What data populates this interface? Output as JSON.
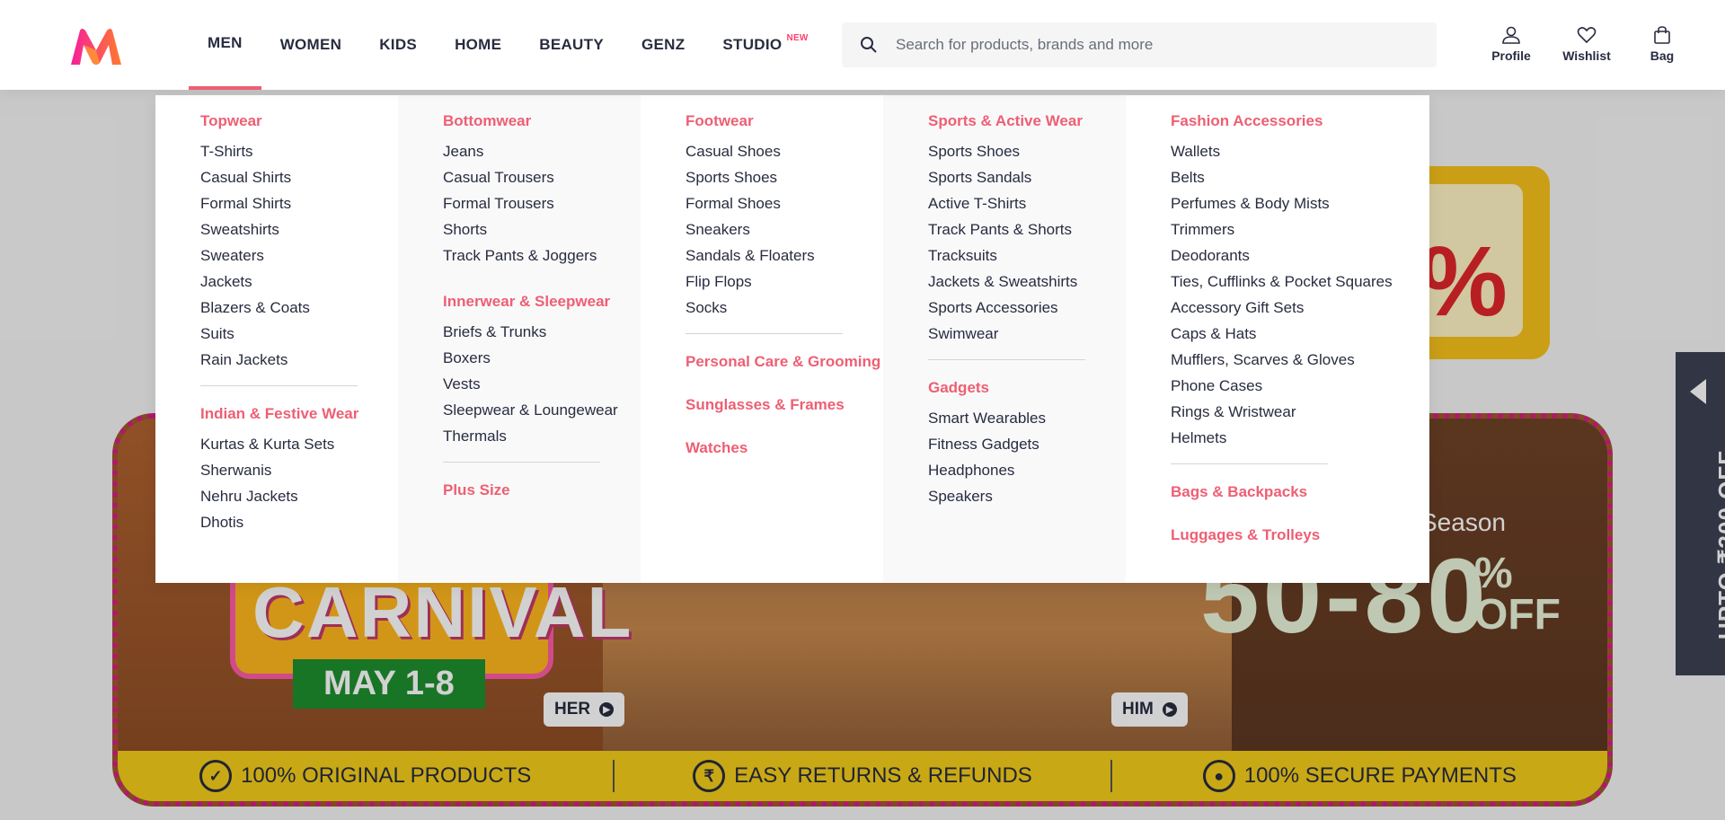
{
  "nav": {
    "items": [
      "MEN",
      "WOMEN",
      "KIDS",
      "HOME",
      "BEAUTY",
      "GENZ",
      "STUDIO"
    ],
    "studio_badge": "NEW"
  },
  "search": {
    "placeholder": "Search for products, brands and more"
  },
  "actions": {
    "profile": "Profile",
    "wishlist": "Wishlist",
    "bag": "Bag"
  },
  "menu": {
    "col1": {
      "g1": {
        "title": "Topwear",
        "items": [
          "T-Shirts",
          "Casual Shirts",
          "Formal Shirts",
          "Sweatshirts",
          "Sweaters",
          "Jackets",
          "Blazers & Coats",
          "Suits",
          "Rain Jackets"
        ]
      },
      "g2": {
        "title": "Indian & Festive Wear",
        "items": [
          "Kurtas & Kurta Sets",
          "Sherwanis",
          "Nehru Jackets",
          "Dhotis"
        ]
      }
    },
    "col2": {
      "g1": {
        "title": "Bottomwear",
        "items": [
          "Jeans",
          "Casual Trousers",
          "Formal Trousers",
          "Shorts",
          "Track Pants & Joggers"
        ]
      },
      "g2": {
        "title": "Innerwear & Sleepwear",
        "items": [
          "Briefs & Trunks",
          "Boxers",
          "Vests",
          "Sleepwear & Loungewear",
          "Thermals"
        ]
      },
      "g3": {
        "title": "Plus Size"
      }
    },
    "col3": {
      "g1": {
        "title": "Footwear",
        "items": [
          "Casual Shoes",
          "Sports Shoes",
          "Formal Shoes",
          "Sneakers",
          "Sandals & Floaters",
          "Flip Flops",
          "Socks"
        ]
      },
      "g2": {
        "title": "Personal Care & Grooming"
      },
      "g3": {
        "title": "Sunglasses & Frames"
      },
      "g4": {
        "title": "Watches"
      }
    },
    "col4": {
      "g1": {
        "title": "Sports & Active Wear",
        "items": [
          "Sports Shoes",
          "Sports Sandals",
          "Active T-Shirts",
          "Track Pants & Shorts",
          "Tracksuits",
          "Jackets & Sweatshirts",
          "Sports Accessories",
          "Swimwear"
        ]
      },
      "g2": {
        "title": "Gadgets",
        "items": [
          "Smart Wearables",
          "Fitness Gadgets",
          "Headphones",
          "Speakers"
        ]
      }
    },
    "col5": {
      "g1": {
        "title": "Fashion Accessories",
        "items": [
          "Wallets",
          "Belts",
          "Perfumes & Body Mists",
          "Trimmers",
          "Deodorants",
          "Ties, Cufflinks & Pocket Squares",
          "Accessory Gift Sets",
          "Caps & Hats",
          "Mufflers, Scarves & Gloves",
          "Phone Cases",
          "Rings & Wristwear",
          "Helmets"
        ]
      },
      "g2": {
        "title": "Bags & Backpacks"
      },
      "g3": {
        "title": "Luggages & Trolleys"
      }
    }
  },
  "banner": {
    "carnival": "CARNIVAL",
    "dates": "MAY 1-8",
    "season": "Season",
    "offer": "50-80",
    "offer_pct": "%",
    "offer_off": "OFF",
    "her": "HER",
    "him": "HIM",
    "trust": [
      "100% ORIGINAL PRODUCTS",
      "EASY RETURNS & REFUNDS",
      "100% SECURE PAYMENTS"
    ]
  },
  "side_tab": {
    "label": "UPTO ₹300 OFF"
  },
  "colors": {
    "accent": "#ee5f73",
    "brand_pink": "#ff3f6c"
  }
}
